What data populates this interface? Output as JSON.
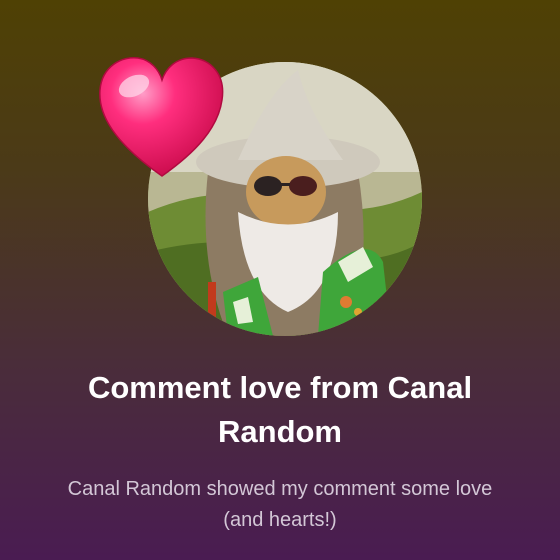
{
  "notification": {
    "title": "Comment love from Canal Random",
    "message": "Canal Random showed my comment some love (and hearts!)",
    "avatar_icon": "channel-avatar-wizard",
    "heart_icon": "heart-icon",
    "heart_color": "#ff2e7e"
  }
}
